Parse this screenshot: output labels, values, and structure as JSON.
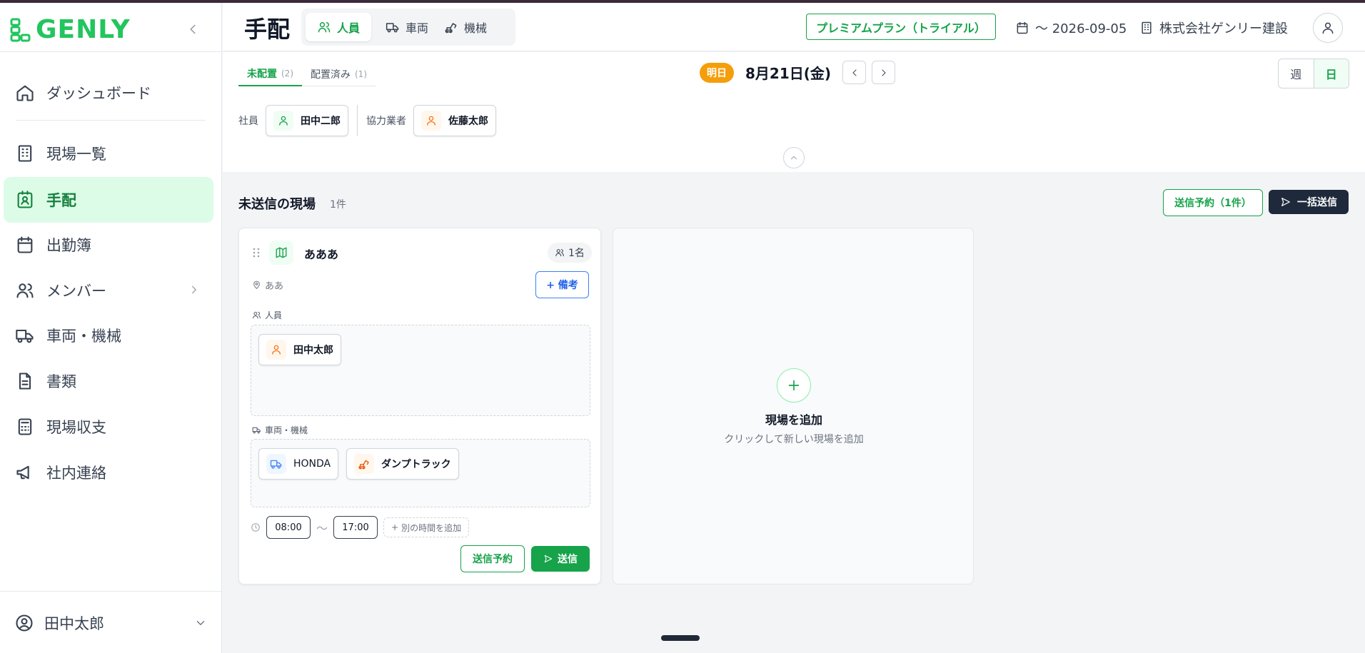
{
  "app": {
    "logo_text": "GENLY",
    "brand_color": "#22c55e"
  },
  "sidebar": {
    "items": [
      {
        "label": "ダッシュボード",
        "icon": "home-icon"
      },
      {
        "label": "現場一覧",
        "icon": "building-icon"
      },
      {
        "label": "手配",
        "icon": "contact-icon",
        "active": true
      },
      {
        "label": "出勤簿",
        "icon": "calendar-icon"
      },
      {
        "label": "メンバー",
        "icon": "users-icon",
        "has_submenu": true
      },
      {
        "label": "車両・機械",
        "icon": "truck-icon"
      },
      {
        "label": "書類",
        "icon": "document-icon"
      },
      {
        "label": "現場収支",
        "icon": "calculator-icon"
      },
      {
        "label": "社内連絡",
        "icon": "megaphone-icon"
      }
    ],
    "user_name": "田中太郎"
  },
  "header": {
    "title": "手配",
    "segments": [
      {
        "label": "人員",
        "icon": "users-icon",
        "active": true
      },
      {
        "label": "車両",
        "icon": "truck-icon"
      },
      {
        "label": "機械",
        "icon": "excavator-icon"
      }
    ],
    "plan_label": "プレミアムプラン（トライアル）",
    "date_range": "〜 2026-09-05",
    "company": "株式会社ゲンリー建設"
  },
  "subpanel": {
    "tabs": [
      {
        "label": "未配置",
        "count": "(2)",
        "active": true
      },
      {
        "label": "配置済み",
        "count": "(1)"
      }
    ],
    "day_badge": "明日",
    "date": "8月21日(金)",
    "view_week": "週",
    "view_day": "日",
    "pool": {
      "employee_label": "社員",
      "employee": "田中二郎",
      "partner_label": "協力業者",
      "partner": "佐藤太郎"
    }
  },
  "main": {
    "section_title": "未送信の現場",
    "section_count": "1件",
    "schedule_all_label": "送信予約（1件）",
    "send_all_label": "一括送信",
    "site": {
      "name": "あああ",
      "member_count": "1名",
      "location": "ああ",
      "note_button": "+ 備考",
      "personnel_label": "人員",
      "personnel": [
        "田中太郎"
      ],
      "equipment_label": "車両・機械",
      "equipment": [
        {
          "name": "HONDA",
          "icon": "truck-icon"
        },
        {
          "name": "ダンプトラック",
          "icon": "excavator-icon"
        }
      ],
      "start_time": "08:00",
      "time_separator": "〜",
      "end_time": "17:00",
      "add_time_label": "別の時間を追加",
      "schedule_label": "送信予約",
      "send_label": "送信"
    },
    "add_site": {
      "title": "現場を追加",
      "subtitle": "クリックして新しい現場を追加"
    }
  },
  "colors": {
    "accent_green": "#16a34a",
    "badge_orange": "#f59e0b",
    "dark_button": "#1e293b",
    "partner_orange": "#f97316"
  }
}
